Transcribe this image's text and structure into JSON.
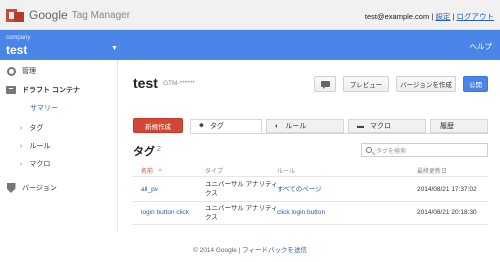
{
  "header": {
    "logo_google": "Google",
    "logo_product": "Tag Manager",
    "user_email": "test@example.com",
    "separator": "|",
    "settings_label": "設定",
    "logout_label": "ログアウト"
  },
  "account_bar": {
    "account_label": "company",
    "container_name": "test",
    "help_label": "ヘルプ"
  },
  "sidebar": {
    "admin_label": "管理",
    "draft_label": "ドラフト コンテナ",
    "summary_label": "サマリー",
    "tags_label": "タグ",
    "rules_label": "ルール",
    "macros_label": "マクロ",
    "versions_label": "バージョン"
  },
  "main": {
    "title": "test",
    "container_id": "GTM-******",
    "preview_label": "プレビュー",
    "create_version_label": "バージョンを作成",
    "publish_label": "公開",
    "new_button_label": "新規作成",
    "tabs": {
      "tags": "タグ",
      "rules": "ルール",
      "macros": "マクロ",
      "history": "履歴"
    },
    "section_title": "タグ",
    "section_count": "2",
    "search_placeholder": "タグを検索",
    "columns": {
      "name": "名前",
      "sort_arrow": "^",
      "type": "タイプ",
      "rule": "ルール",
      "updated": "最終更新日"
    },
    "rows": [
      {
        "name": "all_pv",
        "type_line1": "ユニバーサル アナリティ",
        "type_line2": "クス",
        "rule": "すべてのページ",
        "updated": "2014/08/21 17:37:02"
      },
      {
        "name": "login button click",
        "type_line1": "ユニバーサル アナリティ",
        "type_line2": "クス",
        "rule": "click login button",
        "updated": "2014/08/21 20:18:30"
      }
    ]
  },
  "footer": {
    "copyright": "© 2014 Google",
    "separator": "|",
    "feedback_label": "フィードバックを送信"
  }
}
